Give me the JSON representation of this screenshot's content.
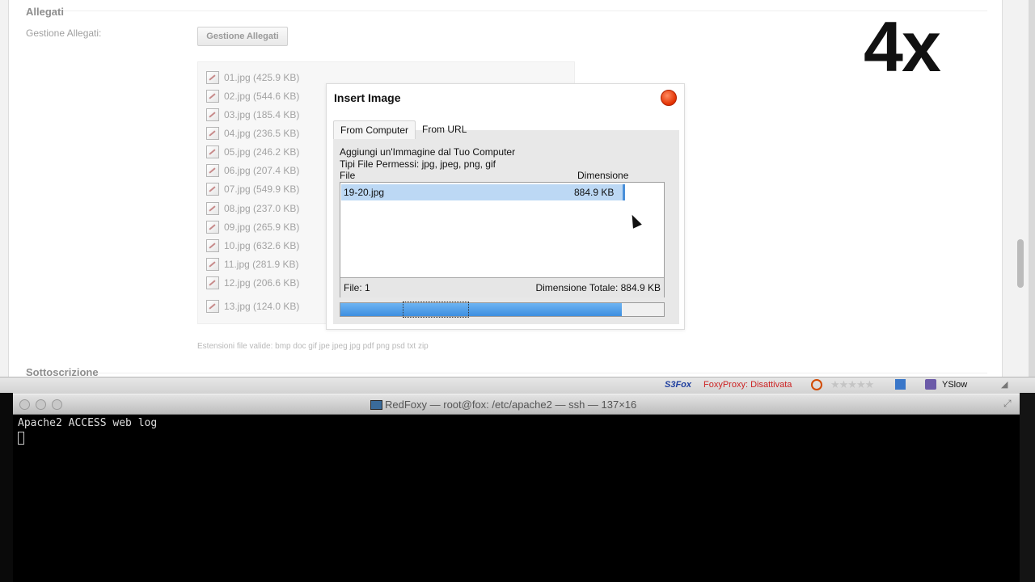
{
  "page": {
    "section_title": "Allegati",
    "manage_label": "Gestione Allegati:",
    "manage_button": "Gestione Allegati",
    "files": [
      "01.jpg (425.9 KB)",
      "02.jpg (544.6 KB)",
      "03.jpg (185.4 KB)",
      "04.jpg (236.5 KB)",
      "05.jpg (246.2 KB)",
      "06.jpg (207.4 KB)",
      "07.jpg (549.9 KB)",
      "08.jpg (237.0 KB)",
      "09.jpg (265.9 KB)",
      "10.jpg (632.6 KB)",
      "11.jpg (281.9 KB)",
      "12.jpg (206.6 KB)",
      "13.jpg (124.0 KB)"
    ],
    "valid_extensions": "Estensioni file valide: bmp doc gif jpe jpeg jpg pdf png psd txt zip",
    "next_section": "Sottoscrizione",
    "overlay_text": "4x"
  },
  "dialog": {
    "title": "Insert Image",
    "tabs": [
      "From Computer",
      "From URL"
    ],
    "active_tab": "From Computer",
    "heading": "Aggiungi un'Immagine dal Tuo Computer",
    "allowed_types": "Tipi File Permessi: jpg, jpeg, png, gif",
    "col_file": "File",
    "col_size": "Dimensione",
    "row": {
      "name": "19-20.jpg",
      "size": "884.9 KB"
    },
    "footer_count": "File: 1",
    "footer_total": "Dimensione Totale: 884.9 KB",
    "progress": 0.87
  },
  "statusbar": {
    "s3fox": "S3Fox",
    "foxyproxy": "FoxyProxy: Disattivata",
    "stars": "★★★★★",
    "yslow": "YSlow"
  },
  "terminal": {
    "title": "RedFoxy — root@fox: /etc/apache2 — ssh — 137×16",
    "line": "Apache2 ACCESS web log"
  },
  "colors": {
    "accent": "#4a90d9",
    "close_button": "#e23000",
    "foxyproxy_text": "#cc2222"
  }
}
